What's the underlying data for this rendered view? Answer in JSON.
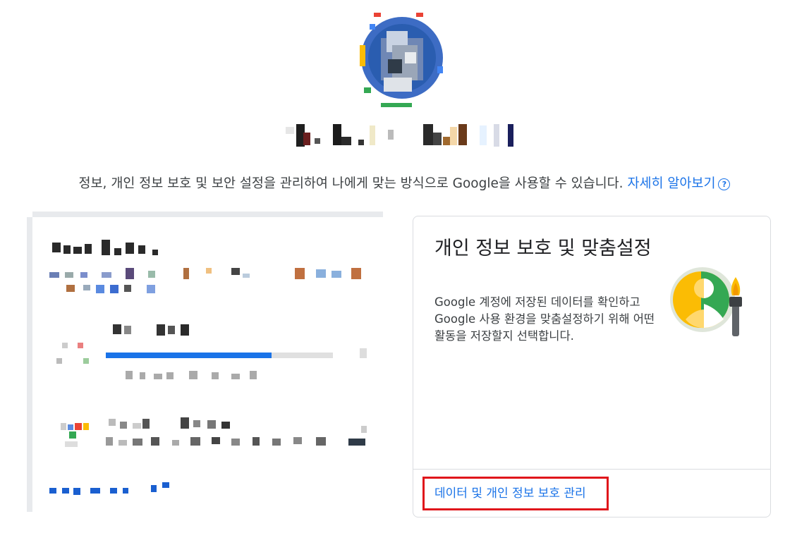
{
  "header": {
    "avatar_icon": "profile-avatar",
    "account_name_pixelated": true
  },
  "intro": {
    "text": "정보, 개인 정보 보호 및 보안 설정을 관리하여 나에게 맞는 방식으로 Google을 사용할 수 있습니다. ",
    "learn_more": "자세히 알아보기",
    "help_icon": "help-circle-icon"
  },
  "privacy_card": {
    "title": "개인 정보 보호 및 맞춤설정",
    "description": "Google 계정에 저장된 데이터를 확인하고 Google 사용 환경을 맞춤설정하기 위해 어떤 활동을 저장할지 선택합니다.",
    "illustration_icon": "privacy-personalization-icon",
    "link": "데이터 및 개인 정보 보호 관리"
  },
  "storage_card": {
    "pixelated": true,
    "progress_fraction": 0.73
  },
  "colors": {
    "link": "#1a73e8",
    "highlight": "#e0161b",
    "google_blue": "#4285f4",
    "google_green": "#34a853",
    "google_yellow": "#fbbc04"
  }
}
